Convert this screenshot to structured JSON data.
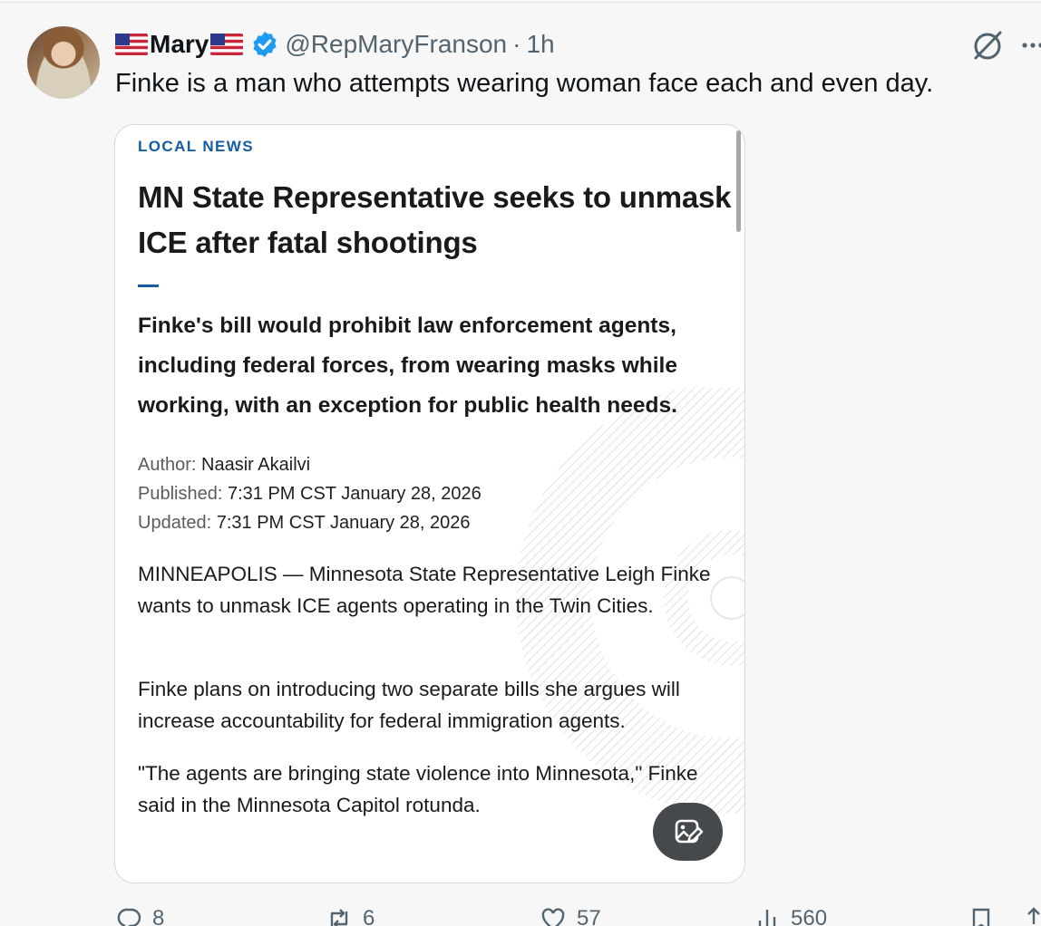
{
  "tweet": {
    "display_name": "Mary",
    "handle": "@RepMaryFranson",
    "separator": "·",
    "time": "1h",
    "text": "Finke is a man who attempts wearing woman face each and even day."
  },
  "card": {
    "section": "LOCAL NEWS",
    "headline": "MN State Representative seeks to unmask ICE after fatal shootings",
    "subheadline": "Finke's bill would prohibit law enforcement agents, including federal forces, from wearing masks while working, with an exception for public health needs.",
    "author_label": "Author:",
    "author": "Naasir Akailvi",
    "published_label": "Published:",
    "published": "7:31 PM CST January 28, 2026",
    "updated_label": "Updated:",
    "updated": "7:31 PM CST January 28, 2026",
    "paragraphs": [
      "MINNEAPOLIS — Minnesota State Representative Leigh Finke wants to unmask ICE agents operating in the Twin Cities.",
      "Finke plans on introducing two separate bills she argues will increase accountability for federal immigration agents.",
      "\"The agents are bringing state violence into Minnesota,\" Finke said in the Minnesota Capitol rotunda."
    ]
  },
  "actions": {
    "replies": "8",
    "reposts": "6",
    "likes": "57",
    "views": "560"
  },
  "colors": {
    "verified": "#1d9bf0",
    "secondary_text": "#536471",
    "section_accent": "#155ca2"
  },
  "icons": [
    "us-flag-icon",
    "verified-badge-icon",
    "grok-icon",
    "more-icon",
    "alt-text-icon",
    "reply-icon",
    "repost-icon",
    "like-icon",
    "views-icon",
    "bookmark-icon",
    "share-icon"
  ]
}
